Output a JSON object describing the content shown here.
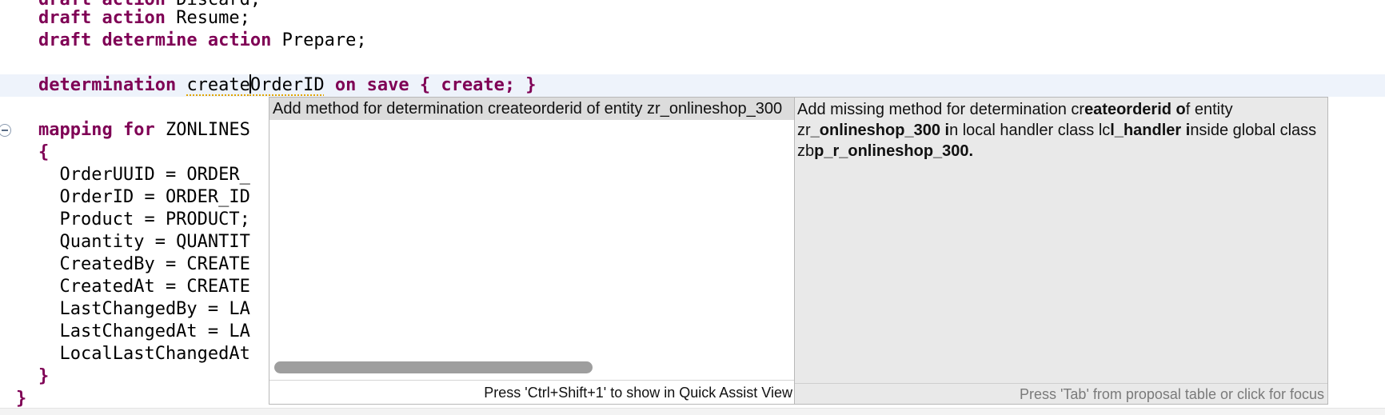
{
  "editor": {
    "lines": [
      {
        "kw1": "draft action",
        "rest": " Discard;"
      },
      {
        "kw1": "draft action",
        "rest": " Resume;"
      },
      {
        "kw1": "draft determine action",
        "rest": " Prepare;"
      },
      {
        "det_kw": "determination",
        "det_name_a": "create",
        "det_name_b": "OrderID",
        "det_on": "on save",
        "det_brace": "{ create; }"
      },
      {
        "kw1": "mapping for",
        "rest": " ZONLINES"
      },
      {
        "text": "{"
      },
      {
        "text": "  OrderUUID = ORDER_"
      },
      {
        "text": "  OrderID = ORDER_ID"
      },
      {
        "text": "  Product = PRODUCT;"
      },
      {
        "text": "  Quantity = QUANTIT"
      },
      {
        "text": "  CreatedBy = CREATE"
      },
      {
        "text": "  CreatedAt = CREATE"
      },
      {
        "text": "  LastChangedBy = LA"
      },
      {
        "text": "  LastChangedAt = LA"
      },
      {
        "text": "  LocalLastChangedAt"
      },
      {
        "text": "}"
      },
      {
        "text": "}"
      }
    ]
  },
  "quickfix": {
    "proposal": "Add method for determination createorderid of entity zr_onlineshop_300",
    "list_footer": "Press 'Ctrl+Shift+1' to show in Quick Assist View",
    "description": {
      "p1": "Add missing method for determination cr",
      "b1": "eateorderid o",
      "p2": "f entity zr",
      "b2": "_onlineshop_300 i",
      "p3": "n local handler class lc",
      "b3": "l_handler i",
      "p4": "nside global class zb",
      "b4": "p_r_onlineshop_300."
    },
    "desc_footer": "Press 'Tab' from proposal table or click for focus"
  }
}
